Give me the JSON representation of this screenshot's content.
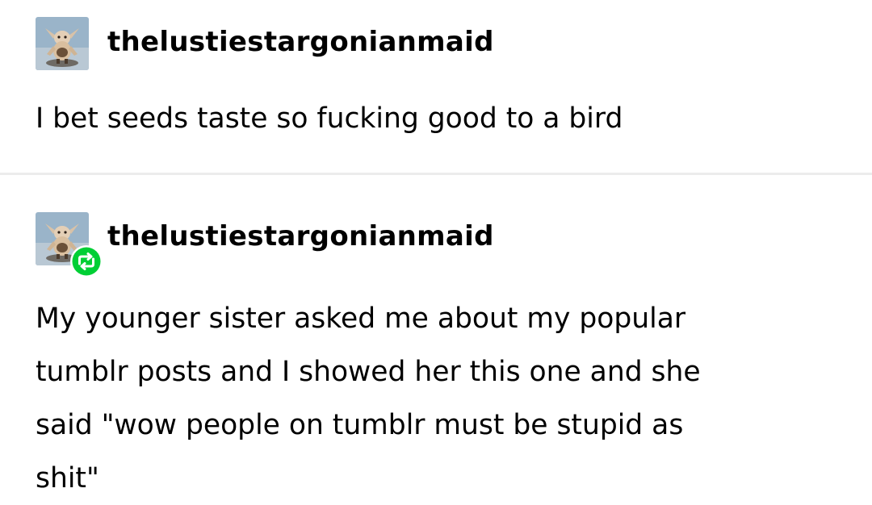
{
  "posts": [
    {
      "username": "thelustiestargonianmaid",
      "text": "I bet seeds taste so fucking good to a bird",
      "avatar_icon": "creature-figurine-avatar",
      "reblog": false
    },
    {
      "username": "thelustiestargonianmaid",
      "text": "My younger sister asked me about my popular\ntumblr posts and I showed her this one and she\nsaid \"wow people on tumblr must be stupid as\nshit\"",
      "avatar_icon": "creature-figurine-avatar",
      "reblog": true,
      "reblog_icon": "reblog-icon"
    }
  ],
  "colors": {
    "reblog_green": "#00cf35",
    "divider": "#ececec",
    "text": "#000000"
  }
}
